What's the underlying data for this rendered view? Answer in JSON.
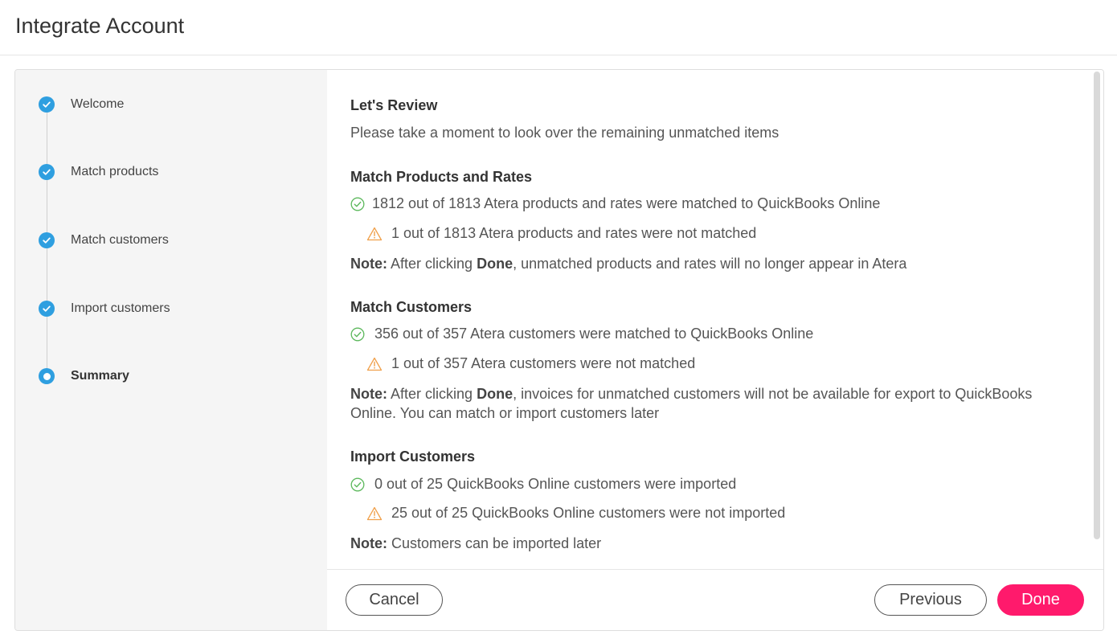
{
  "header": {
    "title": "Integrate Account"
  },
  "steps": [
    {
      "label": "Welcome",
      "state": "done"
    },
    {
      "label": "Match products",
      "state": "done"
    },
    {
      "label": "Match customers",
      "state": "done"
    },
    {
      "label": "Import customers",
      "state": "done"
    },
    {
      "label": "Summary",
      "state": "current"
    }
  ],
  "review": {
    "title": "Let's Review",
    "subtitle": "Please take a moment to look over the remaining unmatched items"
  },
  "sections": {
    "products": {
      "title": "Match Products and Rates",
      "matched": "1812 out of 1813 Atera products and rates were matched to QuickBooks Online",
      "unmatched": "1 out of 1813 Atera products and rates were not matched",
      "note_label": "Note:",
      "note_pre": "After clicking",
      "note_bold": "Done",
      "note_post": ", unmatched products and rates will no longer appear in Atera"
    },
    "customers": {
      "title": "Match Customers",
      "matched": "356 out of 357 Atera customers were matched to QuickBooks Online",
      "unmatched": "1 out of 357 Atera customers were not matched",
      "note_label": "Note:",
      "note_pre": "After clicking",
      "note_bold": "Done",
      "note_post": ", invoices for unmatched customers will not be available for export to QuickBooks Online. You can match or import customers later"
    },
    "import": {
      "title": "Import Customers",
      "matched": "0 out of 25 QuickBooks Online customers were imported",
      "unmatched": "25 out of 25 QuickBooks Online customers were not imported",
      "note_label": "Note:",
      "note_post": "Customers can be imported later"
    }
  },
  "footer": {
    "cancel": "Cancel",
    "previous": "Previous",
    "done": "Done"
  },
  "colors": {
    "step_blue": "#2f9fe0",
    "success_green": "#5cb85c",
    "warning_orange": "#f0a04b",
    "primary_pink": "#ff1a6c"
  },
  "icons": {
    "step_done": "check-circle-icon",
    "step_current": "radio-circle-icon",
    "success": "check-circle-outline-icon",
    "warning": "warning-triangle-icon"
  }
}
